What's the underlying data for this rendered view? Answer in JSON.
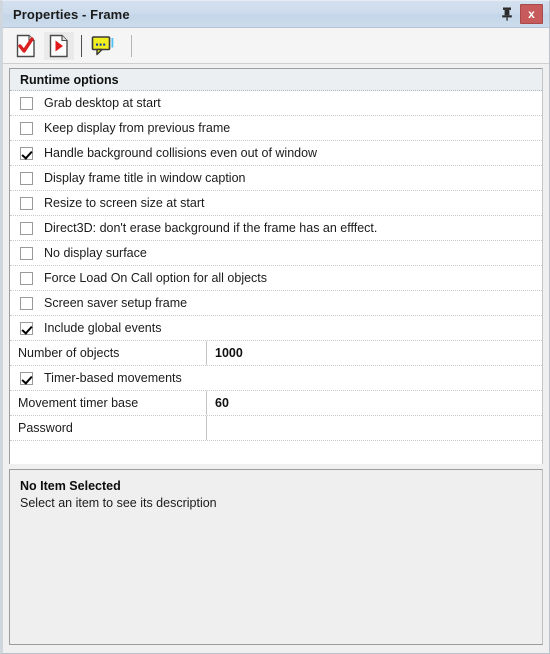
{
  "window": {
    "title": "Properties - Frame",
    "pin_icon": "pushpin-icon",
    "close_label": "x"
  },
  "toolbar": {
    "buttons": [
      {
        "name": "properties-settings-button",
        "icon": "document-check-icon",
        "label": ""
      },
      {
        "name": "properties-events-button",
        "icon": "document-play-icon",
        "label": ""
      },
      {
        "name": "properties-description-button",
        "icon": "comment-balloon-icon",
        "label": ""
      }
    ]
  },
  "properties": {
    "group_title": "Runtime options",
    "checkbox_rows": [
      {
        "label": "Grab desktop at start",
        "checked": false
      },
      {
        "label": "Keep display from previous frame",
        "checked": false
      },
      {
        "label": "Handle background collisions even out of window",
        "checked": true
      },
      {
        "label": "Display frame title in window caption",
        "checked": false
      },
      {
        "label": "Resize to screen size at start",
        "checked": false
      },
      {
        "label": "Direct3D: don't erase background if the frame has an efffect.",
        "checked": false
      },
      {
        "label": "No display surface",
        "checked": false
      },
      {
        "label": "Force Load On Call option for all objects",
        "checked": false
      },
      {
        "label": "Screen saver setup frame",
        "checked": false
      },
      {
        "label": "Include global events",
        "checked": true
      }
    ],
    "number_of_objects": {
      "label": "Number of objects",
      "value": "1000"
    },
    "timer_based_movements": {
      "label": "Timer-based movements",
      "checked": true
    },
    "movement_timer_base": {
      "label": "Movement timer base",
      "value": "60"
    },
    "password": {
      "label": "Password",
      "value": ""
    }
  },
  "description": {
    "title": "No Item Selected",
    "subtitle": "Select an item to see its description"
  }
}
